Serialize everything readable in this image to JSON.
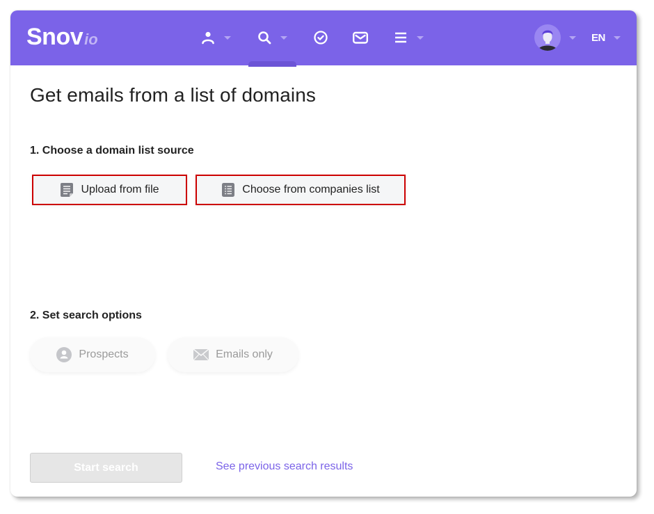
{
  "header": {
    "logo_main": "Snov",
    "logo_sub": "io",
    "nav": [
      {
        "icon": "person-icon",
        "has_dropdown": true
      },
      {
        "icon": "search-icon",
        "has_dropdown": true
      },
      {
        "icon": "check-circle-icon",
        "has_dropdown": false
      },
      {
        "icon": "mail-icon",
        "has_dropdown": false
      },
      {
        "icon": "menu-icon",
        "has_dropdown": true
      }
    ],
    "language": "EN",
    "brand_color": "#7b63e8"
  },
  "main": {
    "title": "Get emails from a list of domains",
    "step1": {
      "label": "1. Choose a domain list source",
      "options": [
        {
          "label": "Upload from file",
          "icon": "file-icon"
        },
        {
          "label": "Choose from companies list",
          "icon": "list-icon"
        }
      ]
    },
    "step2": {
      "label": "2. Set search options",
      "options": [
        {
          "label": "Prospects",
          "icon": "person-circle-icon",
          "enabled": false
        },
        {
          "label": "Emails only",
          "icon": "envelope-icon",
          "enabled": false
        }
      ]
    },
    "start_button": "Start search",
    "start_enabled": false,
    "previous_results_link": "See previous search results"
  }
}
